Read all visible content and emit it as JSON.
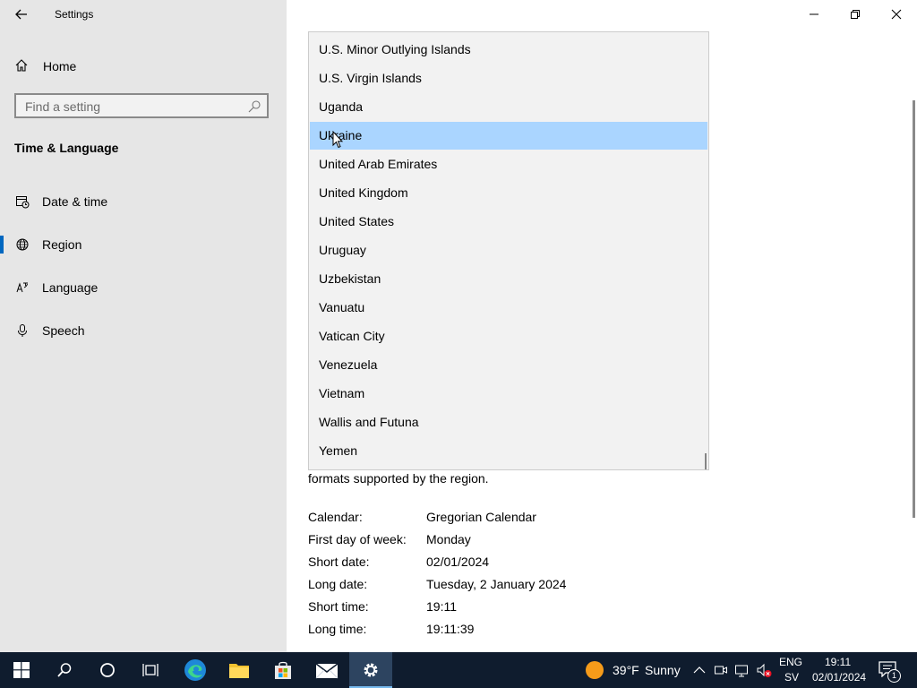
{
  "window": {
    "title": "Settings",
    "controls": {
      "minimize": "minimize-icon",
      "restore": "restore-icon",
      "close": "close-icon"
    }
  },
  "sidebar": {
    "home_label": "Home",
    "search_placeholder": "Find a setting",
    "section_title": "Time & Language",
    "items": [
      {
        "label": "Date & time",
        "icon": "calendar-clock-icon"
      },
      {
        "label": "Region",
        "icon": "globe-icon",
        "active": true
      },
      {
        "label": "Language",
        "icon": "language-icon"
      },
      {
        "label": "Speech",
        "icon": "microphone-icon"
      }
    ]
  },
  "country_dropdown": {
    "options": [
      "U.S. Minor Outlying Islands",
      "U.S. Virgin Islands",
      "Uganda",
      "Ukraine",
      "United Arab Emirates",
      "United Kingdom",
      "United States",
      "Uruguay",
      "Uzbekistan",
      "Vanuatu",
      "Vatican City",
      "Venezuela",
      "Vietnam",
      "Wallis and Futuna",
      "Yemen"
    ],
    "highlighted": "Ukraine"
  },
  "region_format": {
    "partial_text": "formats supported by the region.",
    "rows": [
      {
        "label": "Calendar:",
        "value": "Gregorian Calendar"
      },
      {
        "label": "First day of week:",
        "value": "Monday"
      },
      {
        "label": "Short date:",
        "value": "02/01/2024"
      },
      {
        "label": "Long date:",
        "value": "Tuesday, 2 January 2024"
      },
      {
        "label": "Short time:",
        "value": "19:11"
      },
      {
        "label": "Long time:",
        "value": "19:11:39"
      }
    ]
  },
  "taskbar": {
    "weather": {
      "temp": "39°F",
      "condition": "Sunny"
    },
    "language": {
      "line1": "ENG",
      "line2": "SV"
    },
    "clock": {
      "time": "19:11",
      "date": "02/01/2024"
    },
    "notification_count": "1",
    "colors": {
      "background": "#0f1c2e",
      "accent": "#76b9ed"
    }
  },
  "colors": {
    "accent": "#0067c0",
    "selection": "#aad5ff",
    "sidebar": "#e6e6e6"
  }
}
